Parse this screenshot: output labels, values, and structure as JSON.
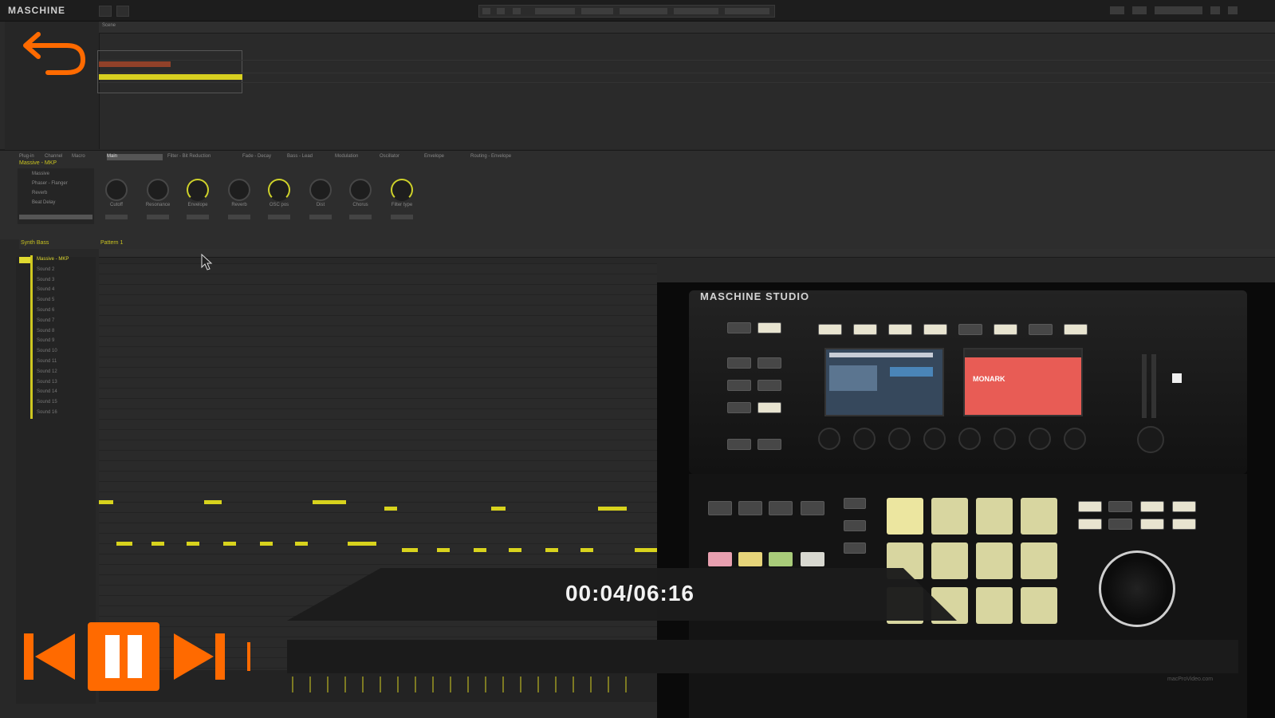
{
  "app": {
    "title": "MASCHINE"
  },
  "arranger": {
    "scene_label": "Scene"
  },
  "control": {
    "tabs": [
      "Plug-in",
      "Channel",
      "Macro",
      "Main",
      "Massive - MKP",
      "Filter - Bit Reduction",
      "Fade - Decay",
      "Bass - Lead",
      "Modulation",
      "Oscillator",
      "Envelope",
      "Routing - Envelope"
    ],
    "plugin_title": "Massive - MKP",
    "plugin_items": [
      "Massive",
      "Phaser - Flanger",
      "Reverb",
      "Beat Delay"
    ],
    "knob_labels": [
      "Cutoff",
      "Resonance",
      "Envelope",
      "Reverb",
      "OSC pos",
      "Dist",
      "Chorus",
      "Filter type"
    ],
    "knob_active": [
      false,
      false,
      true,
      false,
      true,
      false,
      false,
      true
    ]
  },
  "pattern": {
    "group_label": "Synth Bass",
    "pattern_label": "Pattern 1",
    "sounds": [
      "Massive - MKP",
      "Sound 2",
      "Sound 3",
      "Sound 4",
      "Sound 5",
      "Sound 6",
      "Sound 7",
      "Sound 8",
      "Sound 9",
      "Sound 10",
      "Sound 11",
      "Sound 12",
      "Sound 13",
      "Sound 14",
      "Sound 15",
      "Sound 16"
    ]
  },
  "maschine": {
    "logo": "MASCHINE STUDIO",
    "screen_text": "MONARK"
  },
  "player": {
    "time": "00:04/06:16",
    "accent_color": "#ff6a00"
  },
  "watermark": {
    "text": "macProVideo.com"
  }
}
